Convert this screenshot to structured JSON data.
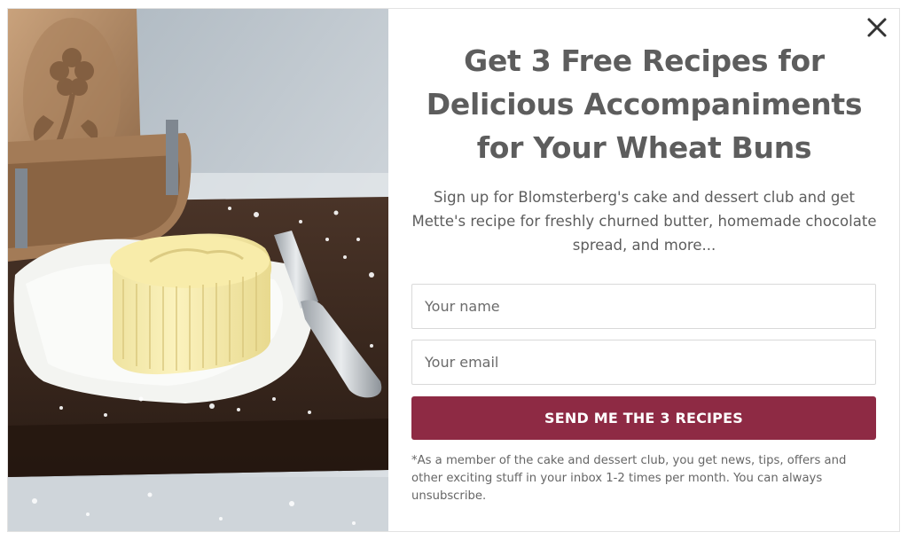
{
  "popup": {
    "headline": "Get 3 Free Recipes for Delicious Accompaniments for Your Wheat Buns",
    "intro": "Sign up for Blomsterberg's cake and dessert club and get Mette's recipe for freshly churned butter, homemade chocolate spread, and more...",
    "name_placeholder": "Your name",
    "email_placeholder": "Your email",
    "submit_label": "SEND ME THE 3 RECIPES",
    "disclaimer": "*As a member of the cake and dessert club, you get news, tips, offers and other exciting stuff in your inbox 1-2 times per month. You can always unsubscribe.",
    "close_icon": "close-icon"
  },
  "colors": {
    "button": "#8e2a44",
    "text": "#5d5d5d",
    "field_border": "#d9d9d9"
  }
}
